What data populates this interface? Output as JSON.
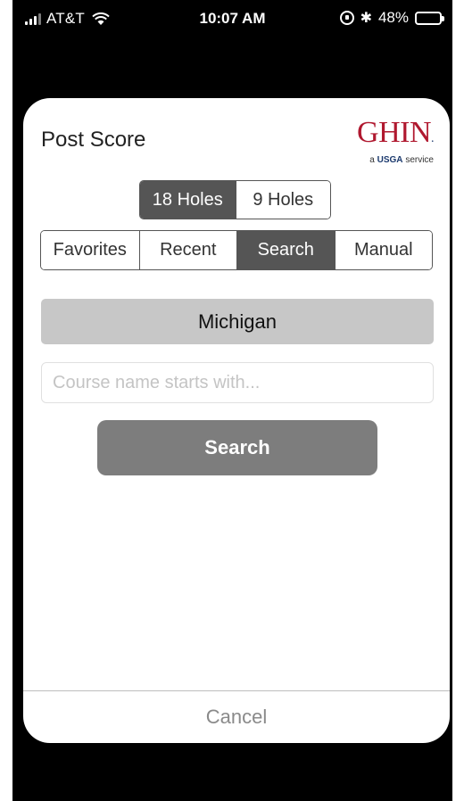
{
  "status_bar": {
    "carrier": "AT&T",
    "time": "10:07 AM",
    "battery": "48%",
    "battery_level": 0.48,
    "icons": [
      "signal-icon",
      "wifi-icon",
      "rotation-lock-icon",
      "bluetooth-icon",
      "battery-icon"
    ]
  },
  "modal": {
    "title": "Post Score",
    "logo": {
      "main": "GHIN",
      "sub_prefix": "a",
      "sub_brand": "USGA",
      "sub_suffix": "service"
    },
    "holes": {
      "options": [
        "18 Holes",
        "9 Holes"
      ],
      "selected": "18 Holes"
    },
    "tabs": {
      "options": [
        "Favorites",
        "Recent",
        "Search",
        "Manual"
      ],
      "selected": "Search"
    },
    "state": "Michigan",
    "course_input": {
      "placeholder": "Course name starts with...",
      "value": ""
    },
    "search_label": "Search",
    "cancel_label": "Cancel"
  },
  "colors": {
    "active_segment": "#555555",
    "state_bg": "#c7c7c7",
    "search_button": "#7d7d7d",
    "logo_red": "#b0182f",
    "logo_blue": "#1c3a6e"
  }
}
